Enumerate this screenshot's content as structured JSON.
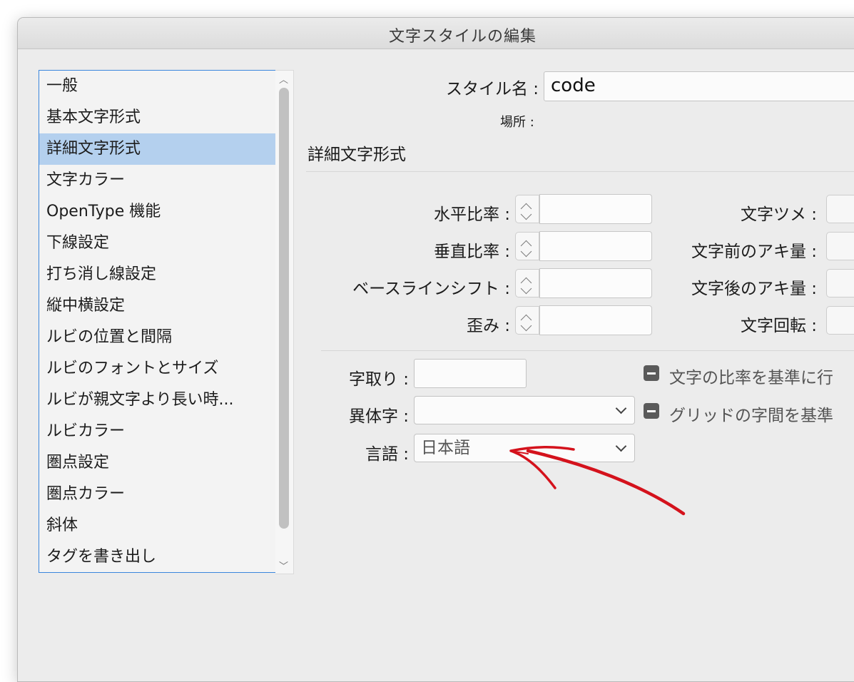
{
  "window": {
    "title": "文字スタイルの編集"
  },
  "list": {
    "items": [
      "一般",
      "基本文字形式",
      "詳細文字形式",
      "文字カラー",
      "OpenType 機能",
      "下線設定",
      "打ち消し線設定",
      "縦中横設定",
      "ルビの位置と間隔",
      "ルビのフォントとサイズ",
      "ルビが親文字より長い時...",
      "ルビカラー",
      "圏点設定",
      "圏点カラー",
      "斜体",
      "タグを書き出し"
    ],
    "selected_index": 2
  },
  "style_name": {
    "label": "スタイル名 :",
    "value": "code"
  },
  "location": {
    "label": "場所 :"
  },
  "section": {
    "title": "詳細文字形式"
  },
  "left_fields": [
    {
      "label": "水平比率 :",
      "value": ""
    },
    {
      "label": "垂直比率 :",
      "value": ""
    },
    {
      "label": "ベースラインシフト :",
      "value": ""
    },
    {
      "label": "歪み :",
      "value": ""
    }
  ],
  "right_fields": [
    {
      "label": "文字ツメ :"
    },
    {
      "label": "文字前のアキ量 :"
    },
    {
      "label": "文字後のアキ量 :"
    },
    {
      "label": "文字回転 :"
    }
  ],
  "jidori": {
    "label": "字取り :",
    "value": ""
  },
  "itaiji": {
    "label": "異体字 :",
    "value": ""
  },
  "language": {
    "label": "言語 :",
    "value": "日本語"
  },
  "checkboxes": [
    {
      "label": "文字の比率を基準に行",
      "state": "mixed"
    },
    {
      "label": "グリッドの字間を基準",
      "state": "mixed"
    }
  ],
  "annotation": {
    "color": "#d4121c"
  }
}
